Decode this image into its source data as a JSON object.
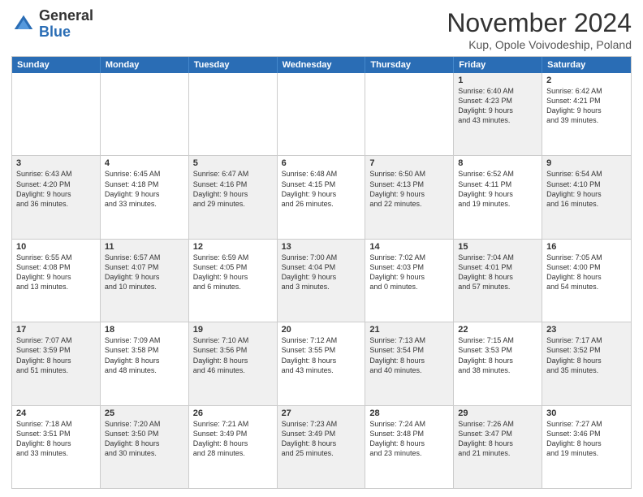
{
  "header": {
    "logo": {
      "general": "General",
      "blue": "Blue"
    },
    "title": "November 2024",
    "subtitle": "Kup, Opole Voivodeship, Poland"
  },
  "weekdays": [
    "Sunday",
    "Monday",
    "Tuesday",
    "Wednesday",
    "Thursday",
    "Friday",
    "Saturday"
  ],
  "rows": [
    [
      {
        "day": "",
        "info": "",
        "empty": true
      },
      {
        "day": "",
        "info": "",
        "empty": true
      },
      {
        "day": "",
        "info": "",
        "empty": true
      },
      {
        "day": "",
        "info": "",
        "empty": true
      },
      {
        "day": "",
        "info": "",
        "empty": true
      },
      {
        "day": "1",
        "info": "Sunrise: 6:40 AM\nSunset: 4:23 PM\nDaylight: 9 hours\nand 43 minutes.",
        "shaded": true
      },
      {
        "day": "2",
        "info": "Sunrise: 6:42 AM\nSunset: 4:21 PM\nDaylight: 9 hours\nand 39 minutes.",
        "shaded": false
      }
    ],
    [
      {
        "day": "3",
        "info": "Sunrise: 6:43 AM\nSunset: 4:20 PM\nDaylight: 9 hours\nand 36 minutes.",
        "shaded": true
      },
      {
        "day": "4",
        "info": "Sunrise: 6:45 AM\nSunset: 4:18 PM\nDaylight: 9 hours\nand 33 minutes.",
        "shaded": false
      },
      {
        "day": "5",
        "info": "Sunrise: 6:47 AM\nSunset: 4:16 PM\nDaylight: 9 hours\nand 29 minutes.",
        "shaded": true
      },
      {
        "day": "6",
        "info": "Sunrise: 6:48 AM\nSunset: 4:15 PM\nDaylight: 9 hours\nand 26 minutes.",
        "shaded": false
      },
      {
        "day": "7",
        "info": "Sunrise: 6:50 AM\nSunset: 4:13 PM\nDaylight: 9 hours\nand 22 minutes.",
        "shaded": true
      },
      {
        "day": "8",
        "info": "Sunrise: 6:52 AM\nSunset: 4:11 PM\nDaylight: 9 hours\nand 19 minutes.",
        "shaded": false
      },
      {
        "day": "9",
        "info": "Sunrise: 6:54 AM\nSunset: 4:10 PM\nDaylight: 9 hours\nand 16 minutes.",
        "shaded": true
      }
    ],
    [
      {
        "day": "10",
        "info": "Sunrise: 6:55 AM\nSunset: 4:08 PM\nDaylight: 9 hours\nand 13 minutes.",
        "shaded": false
      },
      {
        "day": "11",
        "info": "Sunrise: 6:57 AM\nSunset: 4:07 PM\nDaylight: 9 hours\nand 10 minutes.",
        "shaded": true
      },
      {
        "day": "12",
        "info": "Sunrise: 6:59 AM\nSunset: 4:05 PM\nDaylight: 9 hours\nand 6 minutes.",
        "shaded": false
      },
      {
        "day": "13",
        "info": "Sunrise: 7:00 AM\nSunset: 4:04 PM\nDaylight: 9 hours\nand 3 minutes.",
        "shaded": true
      },
      {
        "day": "14",
        "info": "Sunrise: 7:02 AM\nSunset: 4:03 PM\nDaylight: 9 hours\nand 0 minutes.",
        "shaded": false
      },
      {
        "day": "15",
        "info": "Sunrise: 7:04 AM\nSunset: 4:01 PM\nDaylight: 8 hours\nand 57 minutes.",
        "shaded": true
      },
      {
        "day": "16",
        "info": "Sunrise: 7:05 AM\nSunset: 4:00 PM\nDaylight: 8 hours\nand 54 minutes.",
        "shaded": false
      }
    ],
    [
      {
        "day": "17",
        "info": "Sunrise: 7:07 AM\nSunset: 3:59 PM\nDaylight: 8 hours\nand 51 minutes.",
        "shaded": true
      },
      {
        "day": "18",
        "info": "Sunrise: 7:09 AM\nSunset: 3:58 PM\nDaylight: 8 hours\nand 48 minutes.",
        "shaded": false
      },
      {
        "day": "19",
        "info": "Sunrise: 7:10 AM\nSunset: 3:56 PM\nDaylight: 8 hours\nand 46 minutes.",
        "shaded": true
      },
      {
        "day": "20",
        "info": "Sunrise: 7:12 AM\nSunset: 3:55 PM\nDaylight: 8 hours\nand 43 minutes.",
        "shaded": false
      },
      {
        "day": "21",
        "info": "Sunrise: 7:13 AM\nSunset: 3:54 PM\nDaylight: 8 hours\nand 40 minutes.",
        "shaded": true
      },
      {
        "day": "22",
        "info": "Sunrise: 7:15 AM\nSunset: 3:53 PM\nDaylight: 8 hours\nand 38 minutes.",
        "shaded": false
      },
      {
        "day": "23",
        "info": "Sunrise: 7:17 AM\nSunset: 3:52 PM\nDaylight: 8 hours\nand 35 minutes.",
        "shaded": true
      }
    ],
    [
      {
        "day": "24",
        "info": "Sunrise: 7:18 AM\nSunset: 3:51 PM\nDaylight: 8 hours\nand 33 minutes.",
        "shaded": false
      },
      {
        "day": "25",
        "info": "Sunrise: 7:20 AM\nSunset: 3:50 PM\nDaylight: 8 hours\nand 30 minutes.",
        "shaded": true
      },
      {
        "day": "26",
        "info": "Sunrise: 7:21 AM\nSunset: 3:49 PM\nDaylight: 8 hours\nand 28 minutes.",
        "shaded": false
      },
      {
        "day": "27",
        "info": "Sunrise: 7:23 AM\nSunset: 3:49 PM\nDaylight: 8 hours\nand 25 minutes.",
        "shaded": true
      },
      {
        "day": "28",
        "info": "Sunrise: 7:24 AM\nSunset: 3:48 PM\nDaylight: 8 hours\nand 23 minutes.",
        "shaded": false
      },
      {
        "day": "29",
        "info": "Sunrise: 7:26 AM\nSunset: 3:47 PM\nDaylight: 8 hours\nand 21 minutes.",
        "shaded": true
      },
      {
        "day": "30",
        "info": "Sunrise: 7:27 AM\nSunset: 3:46 PM\nDaylight: 8 hours\nand 19 minutes.",
        "shaded": false
      }
    ]
  ]
}
